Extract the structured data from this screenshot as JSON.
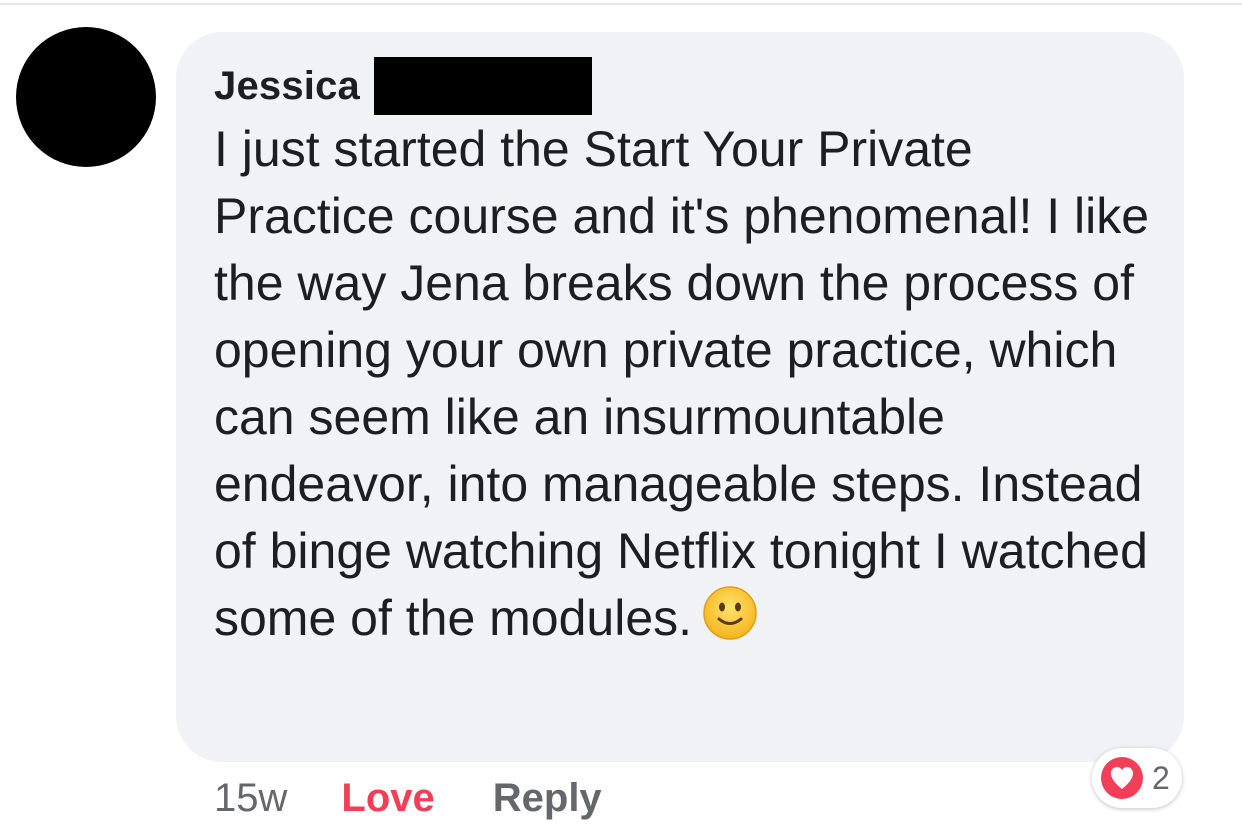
{
  "comment": {
    "author": "Jessica",
    "text": "I just started the Start Your Private Practice course and it's phenomenal! I like the way Jena breaks down the process of opening your own private practice, which can seem like an insurmountable endeavor, into manageable steps. Instead of binge watching Netflix tonight I watched some of the modules.",
    "emoji_icon": "slightly-smiling-face-icon"
  },
  "actions": {
    "time": "15w",
    "love_label": "Love",
    "reply_label": "Reply"
  },
  "reactions": {
    "icon": "heart-icon",
    "count": "2"
  },
  "colors": {
    "bubble_bg": "#f0f2f5",
    "love_red": "#f33e58",
    "muted_text": "#65676b",
    "body_text": "#1c1e21"
  }
}
